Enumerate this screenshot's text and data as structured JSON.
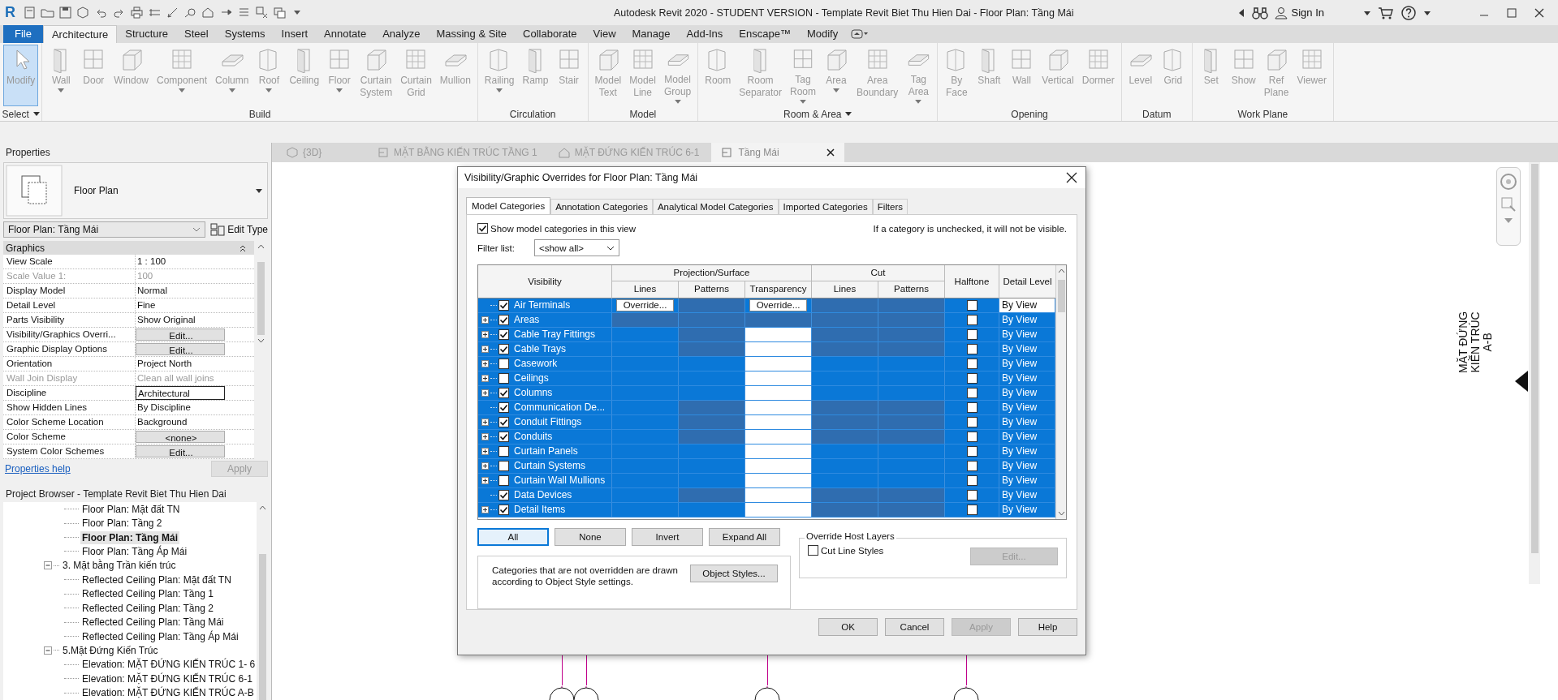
{
  "app": {
    "logo": "R",
    "title": "Autodesk Revit 2020 - STUDENT VERSION - Template Revit Biet Thu Hien Dai - Floor Plan: Tầng Mái",
    "sign_in": "Sign In"
  },
  "ribbon_tabs": [
    {
      "label": "File",
      "kind": "file",
      "selected": false
    },
    {
      "label": "Architecture",
      "kind": "tab",
      "selected": true
    },
    {
      "label": "Structure",
      "kind": "tab",
      "selected": false
    },
    {
      "label": "Steel",
      "kind": "tab",
      "selected": false
    },
    {
      "label": "Systems",
      "kind": "tab",
      "selected": false
    },
    {
      "label": "Insert",
      "kind": "tab",
      "selected": false
    },
    {
      "label": "Annotate",
      "kind": "tab",
      "selected": false
    },
    {
      "label": "Analyze",
      "kind": "tab",
      "selected": false
    },
    {
      "label": "Massing & Site",
      "kind": "tab",
      "selected": false
    },
    {
      "label": "Collaborate",
      "kind": "tab",
      "selected": false
    },
    {
      "label": "View",
      "kind": "tab",
      "selected": false
    },
    {
      "label": "Manage",
      "kind": "tab",
      "selected": false
    },
    {
      "label": "Add-Ins",
      "kind": "tab",
      "selected": false
    },
    {
      "label": "Enscape™",
      "kind": "tab",
      "selected": false
    },
    {
      "label": "Modify",
      "kind": "tab",
      "selected": false
    }
  ],
  "ribbon_panels": [
    {
      "label": "Select",
      "dropdown": true,
      "tools": [
        {
          "label": "Modify",
          "active": true,
          "dropdown": false
        }
      ]
    },
    {
      "label": "Build",
      "dropdown": false,
      "tools": [
        {
          "label": "Wall",
          "active": false,
          "dropdown": true
        },
        {
          "label": "Door",
          "active": false,
          "dropdown": false
        },
        {
          "label": "Window",
          "active": false,
          "dropdown": false
        },
        {
          "label": "Component",
          "active": false,
          "dropdown": true
        },
        {
          "label": "Column",
          "active": false,
          "dropdown": true
        },
        {
          "label": "Roof",
          "active": false,
          "dropdown": true
        },
        {
          "label": "Ceiling",
          "active": false,
          "dropdown": false
        },
        {
          "label": "Floor",
          "active": false,
          "dropdown": true
        },
        {
          "label": "Curtain System",
          "active": false,
          "dropdown": false
        },
        {
          "label": "Curtain Grid",
          "active": false,
          "dropdown": false
        },
        {
          "label": "Mullion",
          "active": false,
          "dropdown": false
        }
      ]
    },
    {
      "label": "Circulation",
      "dropdown": false,
      "tools": [
        {
          "label": "Railing",
          "active": false,
          "dropdown": true
        },
        {
          "label": "Ramp",
          "active": false,
          "dropdown": false
        },
        {
          "label": "Stair",
          "active": false,
          "dropdown": false
        }
      ]
    },
    {
      "label": "Model",
      "dropdown": false,
      "tools": [
        {
          "label": "Model Text",
          "active": false,
          "dropdown": false
        },
        {
          "label": "Model Line",
          "active": false,
          "dropdown": false
        },
        {
          "label": "Model Group",
          "active": false,
          "dropdown": true
        }
      ]
    },
    {
      "label": "Room & Area",
      "dropdown": true,
      "tools": [
        {
          "label": "Room",
          "active": false,
          "dropdown": false
        },
        {
          "label": "Room Separator",
          "active": false,
          "dropdown": false
        },
        {
          "label": "Tag Room",
          "active": false,
          "dropdown": true
        },
        {
          "label": "Area",
          "active": false,
          "dropdown": true
        },
        {
          "label": "Area Boundary",
          "active": false,
          "dropdown": false
        },
        {
          "label": "Tag Area",
          "active": false,
          "dropdown": true
        }
      ]
    },
    {
      "label": "Opening",
      "dropdown": false,
      "tools": [
        {
          "label": "By Face",
          "active": false,
          "dropdown": false
        },
        {
          "label": "Shaft",
          "active": false,
          "dropdown": false
        },
        {
          "label": "Wall",
          "active": false,
          "dropdown": false
        },
        {
          "label": "Vertical",
          "active": false,
          "dropdown": false
        },
        {
          "label": "Dormer",
          "active": false,
          "dropdown": false
        }
      ]
    },
    {
      "label": "Datum",
      "dropdown": false,
      "tools": [
        {
          "label": "Level",
          "active": false,
          "dropdown": false
        },
        {
          "label": "Grid",
          "active": false,
          "dropdown": false
        }
      ]
    },
    {
      "label": "Work Plane",
      "dropdown": false,
      "tools": [
        {
          "label": "Set",
          "active": false,
          "dropdown": false
        },
        {
          "label": "Show",
          "active": false,
          "dropdown": false
        },
        {
          "label": "Ref Plane",
          "active": false,
          "dropdown": false
        },
        {
          "label": "Viewer",
          "active": false,
          "dropdown": false
        }
      ]
    }
  ],
  "view_tabs": [
    {
      "label": "{3D}",
      "selected": false
    },
    {
      "label": "MẶT BẰNG KIẾN TRÚC TẦNG 1",
      "selected": false
    },
    {
      "label": "MẶT ĐỨNG KIẾN TRÚC 6-1",
      "selected": false
    },
    {
      "label": "Tầng Mái",
      "selected": true
    }
  ],
  "properties": {
    "title": "Properties",
    "type_name": "Floor Plan",
    "instance": "Floor Plan: Tầng Mái",
    "edit_type": "Edit Type",
    "group": "Graphics",
    "help": "Properties help",
    "apply": "Apply",
    "rows": [
      {
        "name": "View Scale",
        "value": "1 : 100",
        "kind": "text",
        "disabled": false
      },
      {
        "name": "Scale Value    1:",
        "value": "100",
        "kind": "text",
        "disabled": true
      },
      {
        "name": "Display Model",
        "value": "Normal",
        "kind": "text",
        "disabled": false
      },
      {
        "name": "Detail Level",
        "value": "Fine",
        "kind": "text",
        "disabled": false
      },
      {
        "name": "Parts Visibility",
        "value": "Show Original",
        "kind": "text",
        "disabled": false
      },
      {
        "name": "Visibility/Graphics Overri...",
        "value": "Edit...",
        "kind": "button",
        "disabled": false
      },
      {
        "name": "Graphic Display Options",
        "value": "Edit...",
        "kind": "button",
        "disabled": false
      },
      {
        "name": "Orientation",
        "value": "Project North",
        "kind": "text",
        "disabled": false
      },
      {
        "name": "Wall Join Display",
        "value": "Clean all wall joins",
        "kind": "text",
        "disabled": true
      },
      {
        "name": "Discipline",
        "value": "Architectural",
        "kind": "field",
        "disabled": false
      },
      {
        "name": "Show Hidden Lines",
        "value": "By Discipline",
        "kind": "text",
        "disabled": false
      },
      {
        "name": "Color Scheme Location",
        "value": "Background",
        "kind": "text",
        "disabled": false
      },
      {
        "name": "Color Scheme",
        "value": "<none>",
        "kind": "button",
        "disabled": false
      },
      {
        "name": "System Color Schemes",
        "value": "Edit...",
        "kind": "button",
        "disabled": false
      }
    ]
  },
  "browser": {
    "title": "Project Browser - Template Revit Biet Thu Hien Dai",
    "leading_items": [
      {
        "label": "Floor Plan: Mặt đất TN",
        "selected": false
      },
      {
        "label": "Floor Plan: Tầng 2",
        "selected": false
      },
      {
        "label": "Floor Plan: Tầng Mái",
        "selected": true
      },
      {
        "label": "Floor Plan: Tầng Áp Mái",
        "selected": false
      }
    ],
    "groups": [
      {
        "label": "3. Mặt bằng Trần kiến trúc",
        "expanded": true,
        "children": [
          {
            "label": "Reflected Ceiling Plan: Mặt đất TN",
            "selected": false
          },
          {
            "label": "Reflected Ceiling Plan: Tầng 1",
            "selected": false
          },
          {
            "label": "Reflected Ceiling Plan: Tầng 2",
            "selected": false
          },
          {
            "label": "Reflected Ceiling Plan: Tầng Mái",
            "selected": false
          },
          {
            "label": "Reflected Ceiling Plan: Tầng Áp Mái",
            "selected": false
          }
        ]
      },
      {
        "label": "5.Mặt Đứng Kiến Trúc",
        "expanded": true,
        "children": [
          {
            "label": "Elevation: MẶT ĐỨNG KIẾN TRÚC 1- 6",
            "selected": false
          },
          {
            "label": "Elevation: MẶT ĐỨNG KIẾN TRÚC 6-1",
            "selected": false
          },
          {
            "label": "Elevation: MẶT ĐỨNG KIẾN TRÚC A-B",
            "selected": false
          }
        ]
      }
    ]
  },
  "dialog": {
    "title": "Visibility/Graphic Overrides for Floor Plan: Tầng Mái",
    "tabs": [
      {
        "label": "Model Categories",
        "selected": true
      },
      {
        "label": "Annotation Categories",
        "selected": false
      },
      {
        "label": "Analytical Model Categories",
        "selected": false
      },
      {
        "label": "Imported Categories",
        "selected": false
      },
      {
        "label": "Filters",
        "selected": false
      }
    ],
    "show_checkbox": {
      "label": "Show model categories in this view",
      "checked": true
    },
    "note": "If a category is unchecked, it will not be visible.",
    "filter": {
      "label": "Filter list:",
      "value": "<show all>"
    },
    "header": {
      "visibility": "Visibility",
      "projection": "Projection/Surface",
      "cut": "Cut",
      "halftone": "Halftone",
      "detail": "Detail Level",
      "lines": "Lines",
      "patterns": "Patterns",
      "transparency": "Transparency",
      "cut_lines": "Lines",
      "cut_patterns": "Patterns"
    },
    "rows": [
      {
        "name": "Air Terminals",
        "expandable": false,
        "checked": true,
        "current": true,
        "selected": true,
        "cells": [
          {
            "kind": "button",
            "text": "Override..."
          },
          {
            "kind": "dim"
          },
          {
            "kind": "button",
            "text": "Override..."
          },
          {
            "kind": "dim"
          },
          {
            "kind": "dim"
          }
        ],
        "halftone": false,
        "detail": "By View"
      },
      {
        "name": "Areas",
        "expandable": true,
        "checked": true,
        "current": false,
        "selected": true,
        "cells": [
          {
            "kind": "dim"
          },
          {
            "kind": "dim"
          },
          {
            "kind": "dim"
          },
          {
            "kind": "dim"
          },
          {
            "kind": "dim"
          }
        ],
        "halftone": false,
        "detail": "By View"
      },
      {
        "name": "Cable Tray Fittings",
        "expandable": true,
        "checked": true,
        "current": false,
        "selected": true,
        "cells": [
          {
            "kind": "blank"
          },
          {
            "kind": "dim"
          },
          {
            "kind": "white"
          },
          {
            "kind": "dim"
          },
          {
            "kind": "dim"
          }
        ],
        "halftone": false,
        "detail": "By View"
      },
      {
        "name": "Cable Trays",
        "expandable": true,
        "checked": true,
        "current": false,
        "selected": true,
        "cells": [
          {
            "kind": "blank"
          },
          {
            "kind": "dim"
          },
          {
            "kind": "white"
          },
          {
            "kind": "dim"
          },
          {
            "kind": "dim"
          }
        ],
        "halftone": false,
        "detail": "By View"
      },
      {
        "name": "Casework",
        "expandable": true,
        "checked": false,
        "current": false,
        "selected": true,
        "cells": [
          {
            "kind": "blank"
          },
          {
            "kind": "blank"
          },
          {
            "kind": "white"
          },
          {
            "kind": "blank"
          },
          {
            "kind": "blank"
          }
        ],
        "halftone": false,
        "detail": "By View"
      },
      {
        "name": "Ceilings",
        "expandable": true,
        "checked": false,
        "current": false,
        "selected": true,
        "cells": [
          {
            "kind": "blank"
          },
          {
            "kind": "blank"
          },
          {
            "kind": "white"
          },
          {
            "kind": "blank"
          },
          {
            "kind": "blank"
          }
        ],
        "halftone": false,
        "detail": "By View"
      },
      {
        "name": "Columns",
        "expandable": true,
        "checked": true,
        "current": false,
        "selected": true,
        "cells": [
          {
            "kind": "blank"
          },
          {
            "kind": "blank"
          },
          {
            "kind": "white"
          },
          {
            "kind": "blank"
          },
          {
            "kind": "blank"
          }
        ],
        "halftone": false,
        "detail": "By View"
      },
      {
        "name": "Communication De...",
        "expandable": false,
        "checked": true,
        "current": false,
        "selected": true,
        "cells": [
          {
            "kind": "blank"
          },
          {
            "kind": "dim"
          },
          {
            "kind": "white"
          },
          {
            "kind": "dim"
          },
          {
            "kind": "dim"
          }
        ],
        "halftone": false,
        "detail": "By View"
      },
      {
        "name": "Conduit Fittings",
        "expandable": true,
        "checked": true,
        "current": false,
        "selected": true,
        "cells": [
          {
            "kind": "blank"
          },
          {
            "kind": "dim"
          },
          {
            "kind": "white"
          },
          {
            "kind": "dim"
          },
          {
            "kind": "dim"
          }
        ],
        "halftone": false,
        "detail": "By View"
      },
      {
        "name": "Conduits",
        "expandable": true,
        "checked": true,
        "current": false,
        "selected": true,
        "cells": [
          {
            "kind": "blank"
          },
          {
            "kind": "dim"
          },
          {
            "kind": "white"
          },
          {
            "kind": "dim"
          },
          {
            "kind": "dim"
          }
        ],
        "halftone": false,
        "detail": "By View"
      },
      {
        "name": "Curtain Panels",
        "expandable": true,
        "checked": false,
        "current": false,
        "selected": true,
        "cells": [
          {
            "kind": "blank"
          },
          {
            "kind": "blank"
          },
          {
            "kind": "white"
          },
          {
            "kind": "blank"
          },
          {
            "kind": "blank"
          }
        ],
        "halftone": false,
        "detail": "By View"
      },
      {
        "name": "Curtain Systems",
        "expandable": true,
        "checked": false,
        "current": false,
        "selected": true,
        "cells": [
          {
            "kind": "blank"
          },
          {
            "kind": "blank"
          },
          {
            "kind": "white"
          },
          {
            "kind": "blank"
          },
          {
            "kind": "blank"
          }
        ],
        "halftone": false,
        "detail": "By View"
      },
      {
        "name": "Curtain Wall Mullions",
        "expandable": true,
        "checked": false,
        "current": false,
        "selected": true,
        "cells": [
          {
            "kind": "blank"
          },
          {
            "kind": "blank"
          },
          {
            "kind": "white"
          },
          {
            "kind": "blank"
          },
          {
            "kind": "blank"
          }
        ],
        "halftone": false,
        "detail": "By View"
      },
      {
        "name": "Data Devices",
        "expandable": false,
        "checked": true,
        "current": false,
        "selected": true,
        "cells": [
          {
            "kind": "blank"
          },
          {
            "kind": "dim"
          },
          {
            "kind": "white"
          },
          {
            "kind": "dim"
          },
          {
            "kind": "dim"
          }
        ],
        "halftone": false,
        "detail": "By View"
      },
      {
        "name": "Detail Items",
        "expandable": true,
        "checked": true,
        "current": false,
        "selected": true,
        "cells": [
          {
            "kind": "blank"
          },
          {
            "kind": "blank"
          },
          {
            "kind": "white"
          },
          {
            "kind": "dim"
          },
          {
            "kind": "dim"
          }
        ],
        "halftone": false,
        "detail": "By View"
      }
    ],
    "row_buttons": [
      "All",
      "None",
      "Invert",
      "Expand All"
    ],
    "info": "Categories that are not overridden are drawn according to Object Style settings.",
    "object_styles": "Object Styles...",
    "host_layers": {
      "title": "Override Host Layers",
      "checkbox": {
        "label": "Cut Line Styles",
        "checked": false
      },
      "edit": {
        "label": "Edit...",
        "disabled": true
      }
    },
    "footer_buttons": [
      {
        "label": "OK",
        "disabled": false
      },
      {
        "label": "Cancel",
        "disabled": false
      },
      {
        "label": "Apply",
        "disabled": true
      },
      {
        "label": "Help",
        "disabled": false
      }
    ]
  },
  "canvas": {
    "elevation_tag": [
      "MẶT ĐỨNG",
      "KIẾN TRÚC",
      "A-B"
    ]
  }
}
